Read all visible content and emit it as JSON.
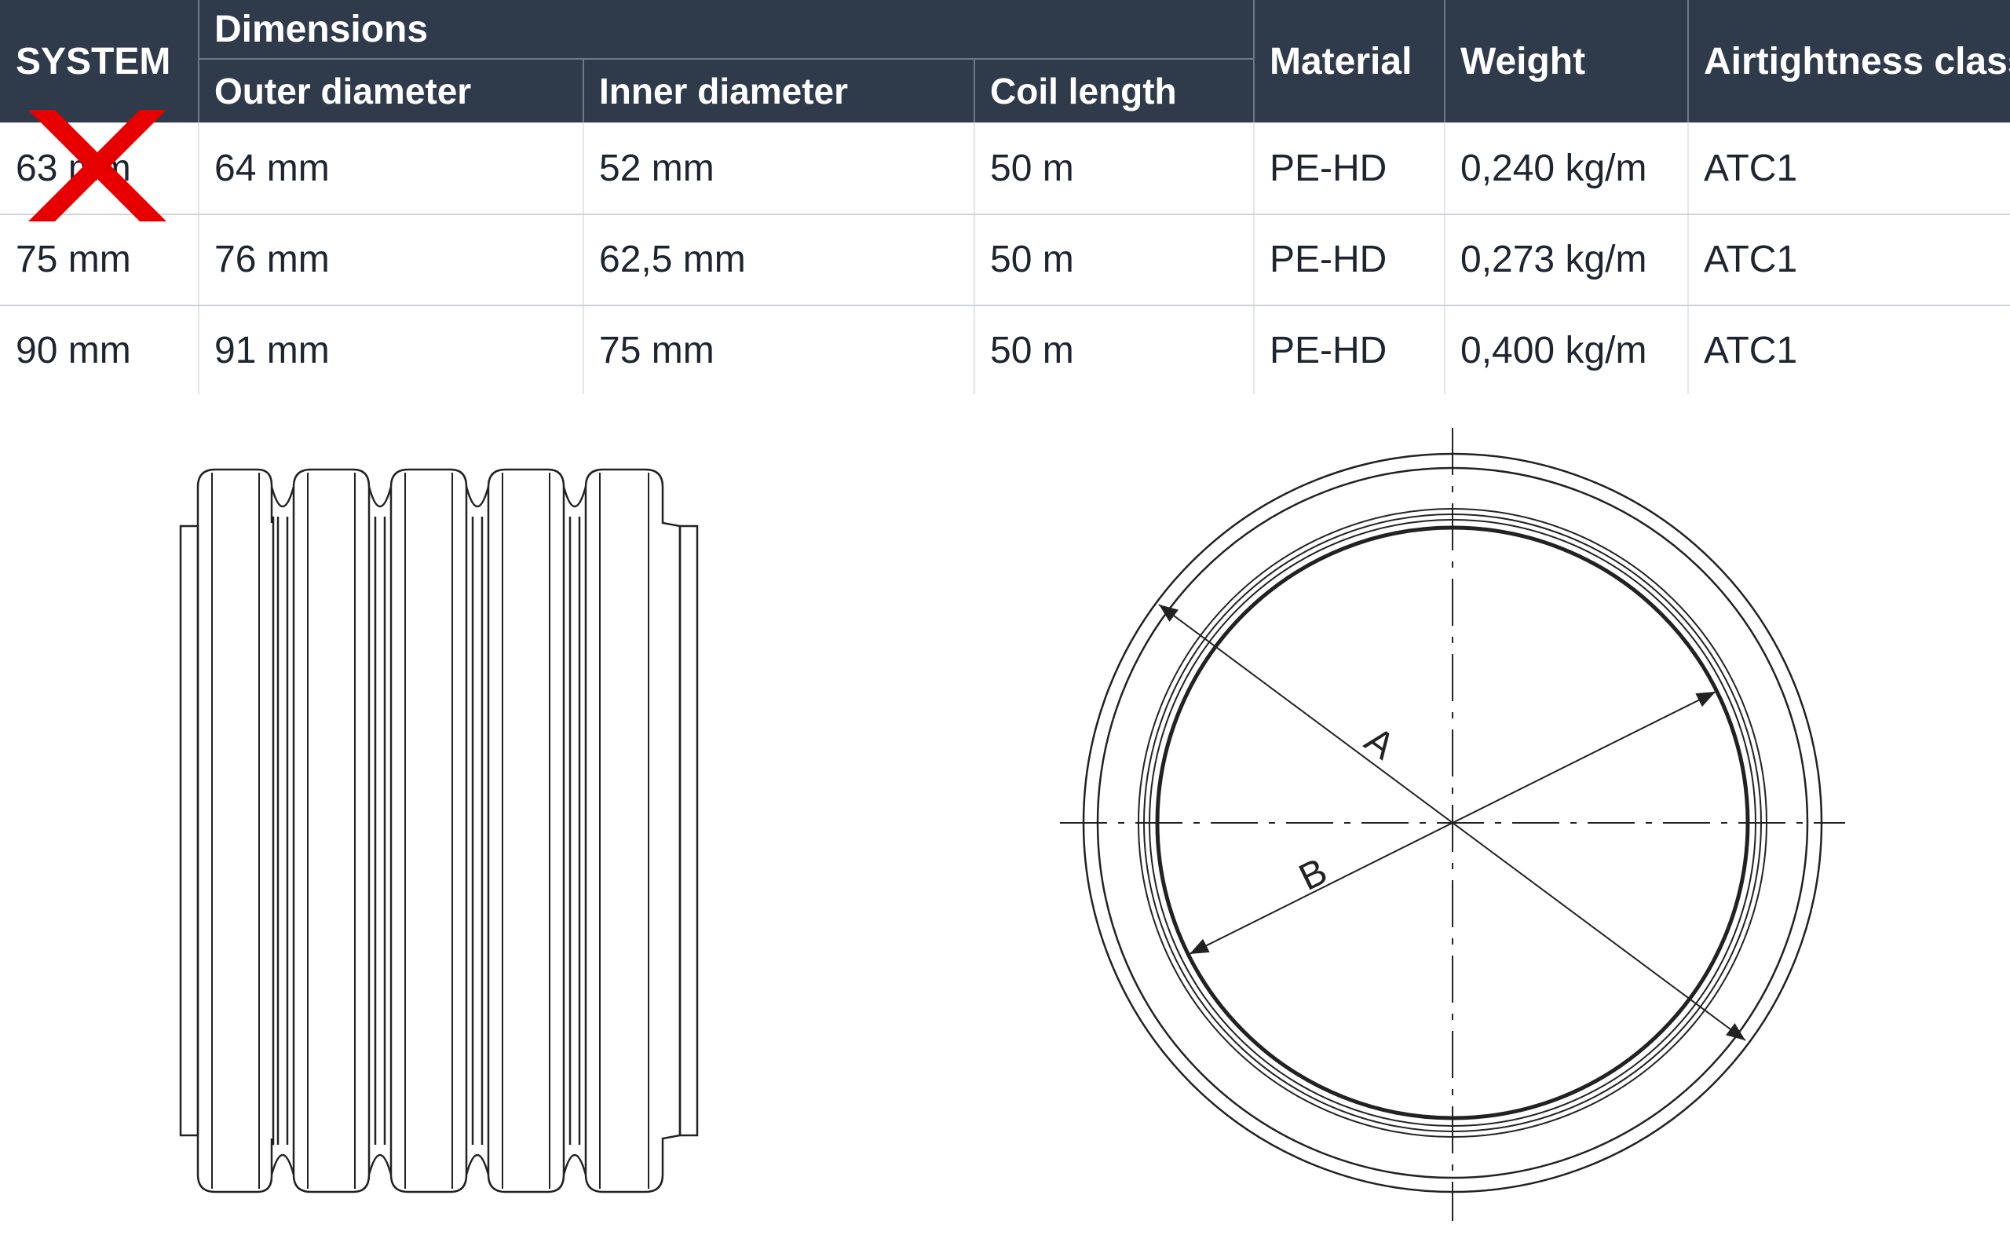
{
  "table": {
    "header": {
      "system": "SYSTEM",
      "dimensions": "Dimensions",
      "outer_diameter": "Outer diameter",
      "inner_diameter": "Inner diameter",
      "coil_length": "Coil length",
      "material": "Material",
      "weight": "Weight",
      "airtightness_class": "Airtightness class"
    },
    "rows": [
      {
        "system": "63 mm",
        "outer": "64 mm",
        "inner": "52 mm",
        "coil": "50 m",
        "material": "PE-HD",
        "weight": "0,240 kg/m",
        "atc": "ATC1",
        "struck_out": true
      },
      {
        "system": "75 mm",
        "outer": "76 mm",
        "inner": "62,5 mm",
        "coil": "50 m",
        "material": "PE-HD",
        "weight": "0,273 kg/m",
        "atc": "ATC1",
        "struck_out": false
      },
      {
        "system": "90 mm",
        "outer": "91 mm",
        "inner": "75 mm",
        "coil": "50 m",
        "material": "PE-HD",
        "weight": "0,400 kg/m",
        "atc": "ATC1",
        "struck_out": false
      }
    ]
  },
  "drawings": {
    "side_view_icon": "corrugated-pipe-side-view",
    "section_view_icon": "pipe-cross-section",
    "dimension_a": "A",
    "dimension_b": "B"
  },
  "colors": {
    "header_bg": "#2f3a4b",
    "header_text": "#ffffff",
    "strike_mark": "#e60000",
    "line_art": "#222222"
  }
}
